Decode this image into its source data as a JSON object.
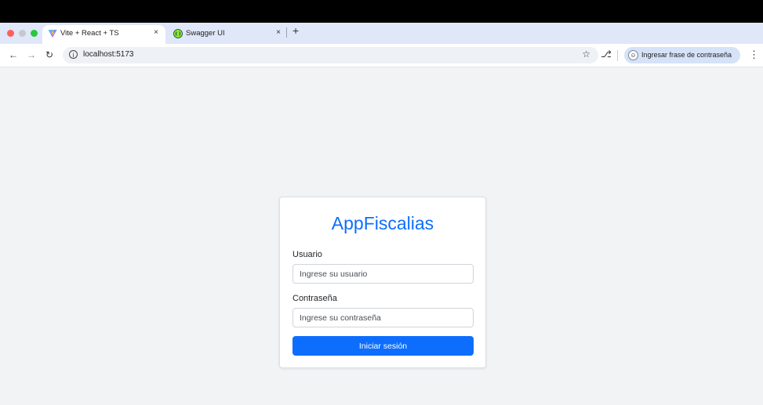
{
  "browser": {
    "tabs": [
      {
        "title": "Vite + React + TS",
        "active": true,
        "favicon": "vite-icon"
      },
      {
        "title": "Swagger UI",
        "active": false,
        "favicon": "swagger-icon"
      }
    ],
    "new_tab_symbol": "+",
    "tab_close_symbol": "×",
    "address": "localhost:5173",
    "password_chip_label": "Ingresar frase de contraseña"
  },
  "login": {
    "title": "AppFiscalias",
    "username_label": "Usuario",
    "username_placeholder": "Ingrese su usuario",
    "password_label": "Contraseña",
    "password_placeholder": "Ingrese su contraseña",
    "submit_label": "Iniciar sesión"
  },
  "colors": {
    "primary": "#0d6efd",
    "page_background": "#f2f3f5",
    "tabstrip_background": "#dfe7f8"
  }
}
